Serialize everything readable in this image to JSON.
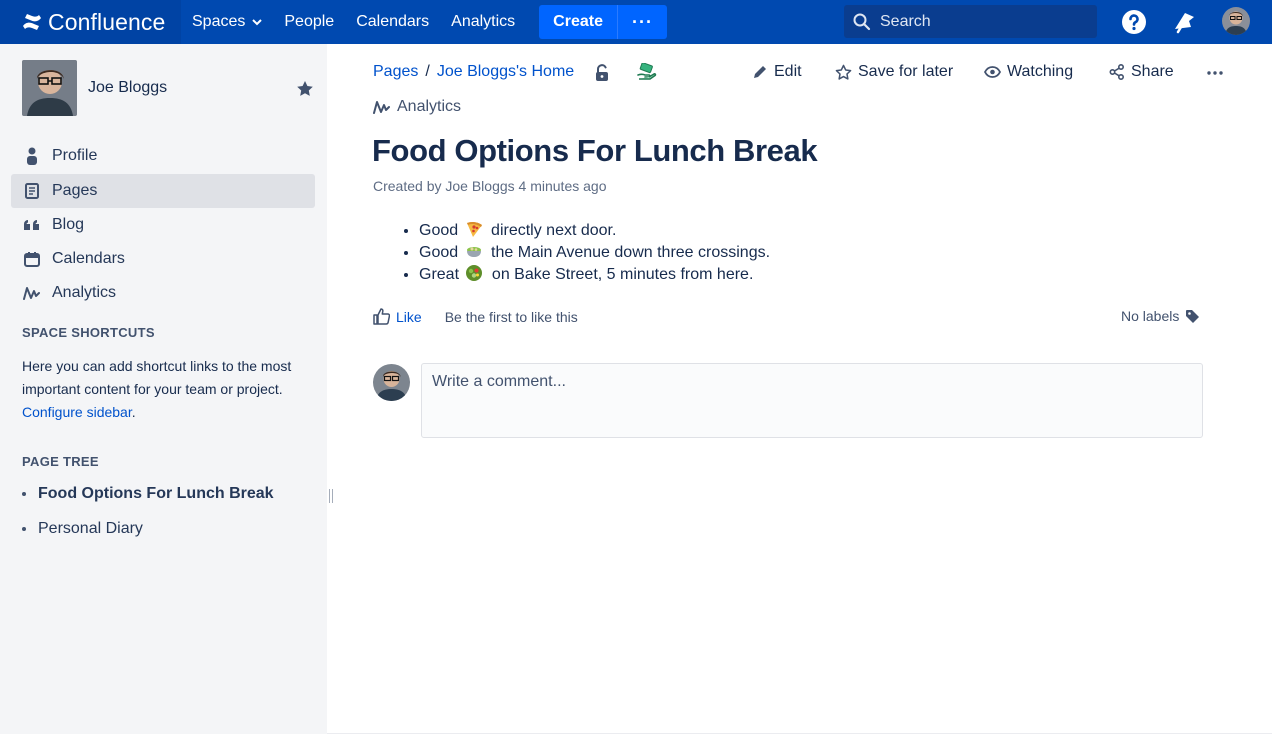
{
  "topnav": {
    "logo": "Confluence",
    "links": [
      "Spaces",
      "People",
      "Calendars",
      "Analytics"
    ],
    "create_label": "Create",
    "more_label": "···",
    "search_placeholder": "Search",
    "brand_color": "#0049b0"
  },
  "sidebar": {
    "user_name": "Joe Bloggs",
    "items": [
      {
        "label": "Profile",
        "icon": "person-icon"
      },
      {
        "label": "Pages",
        "icon": "page-icon",
        "active": true
      },
      {
        "label": "Blog",
        "icon": "quote-icon"
      },
      {
        "label": "Calendars",
        "icon": "calendar-icon"
      },
      {
        "label": "Analytics",
        "icon": "analytics-icon"
      }
    ],
    "shortcuts_title": "SPACE SHORTCUTS",
    "shortcuts_text": "Here you can add shortcut links to the most important content for your team or project.",
    "configure_link": "Configure sidebar",
    "shortcuts_period": ".",
    "tree_title": "PAGE TREE",
    "tree": [
      {
        "label": "Food Options For Lunch Break",
        "current": true
      },
      {
        "label": "Personal Diary",
        "current": false
      }
    ]
  },
  "page": {
    "breadcrumb": [
      "Pages",
      "Joe Bloggs's Home"
    ],
    "breadcrumb_sep": "/",
    "actions": {
      "edit": "Edit",
      "save": "Save for later",
      "watch": "Watching",
      "share": "Share"
    },
    "analytics": "Analytics",
    "title": "Food Options For Lunch Break",
    "byline": "Created by Joe Bloggs 4 minutes ago",
    "items": [
      {
        "before": "Good",
        "emoji": "pizza-emoji",
        "after": "directly next door."
      },
      {
        "before": "Good",
        "emoji": "bowl-emoji",
        "after": "the Main Avenue down three crossings."
      },
      {
        "before": "Great",
        "emoji": "salad-emoji",
        "after": "on Bake Street, 5 minutes from here."
      }
    ],
    "like_label": "Like",
    "like_hint": "Be the first to like this",
    "labels": "No labels",
    "comment_placeholder": "Write a comment..."
  }
}
